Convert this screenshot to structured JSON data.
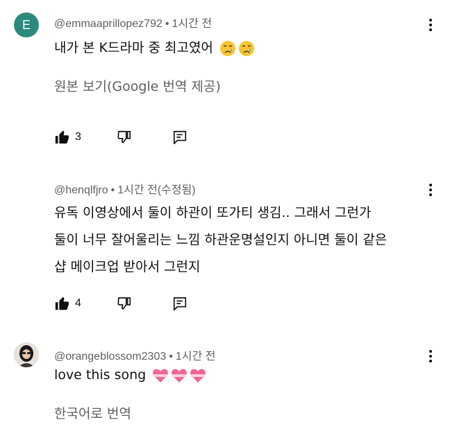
{
  "comments": [
    {
      "avatar_letter": "E",
      "avatar_color": "#2a8a7c",
      "author": "@emmaaprillopez792",
      "separator": "•",
      "time": "1시간 전",
      "text_lines": [
        "내가 본 K드라마 중 최고였어"
      ],
      "emoji": [
        "crying-face",
        "crying-face"
      ],
      "translate_label": "원본 보기(Google 번역 제공)",
      "likes": "3"
    },
    {
      "author": "@henqlfjro",
      "separator": "•",
      "time": "1시간 전(수정됨)",
      "text_lines": [
        "유독 이영상에서 둘이 하관이 또가티 생김.. 그래서 그런가",
        "둘이 너무 잘어울리는 느낌 하관운명설인지 아니면 둘이 같은",
        "샵 메이크업 받아서 그런지"
      ],
      "likes": "4"
    },
    {
      "avatar_image": "profile-photo",
      "author": "@orangeblossom2303",
      "separator": "•",
      "time": "1시간 전",
      "text_lines": [
        "love this song"
      ],
      "emoji": [
        "heart-ribbon",
        "heart-ribbon",
        "heart-ribbon"
      ],
      "translate_label": "한국어로 번역"
    }
  ],
  "colors": {
    "text": "#0f0f0f",
    "meta": "#606060"
  },
  "icons": [
    "like-icon",
    "dislike-icon",
    "reply-icon",
    "more-options-icon"
  ]
}
